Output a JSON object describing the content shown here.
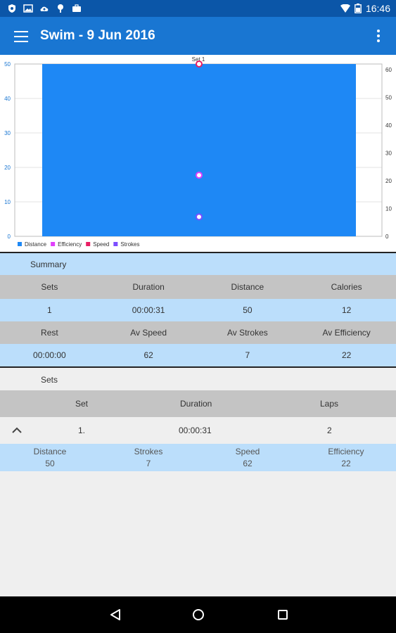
{
  "status_bar": {
    "time": "16:46",
    "left_icons": [
      "shield-icon",
      "image-icon",
      "cloud-upload-icon",
      "location-icon",
      "briefcase-icon"
    ],
    "right_icons": [
      "wifi-icon",
      "battery-icon"
    ]
  },
  "app_bar": {
    "title": "Swim - 9 Jun 2016",
    "background": "#1976d2"
  },
  "chart_data": {
    "type": "bar",
    "title": "Set 1",
    "categories": [
      "Set 1"
    ],
    "left_axis": {
      "ticks": [
        "0",
        "10",
        "20",
        "30",
        "40",
        "50"
      ],
      "ylim": [
        0,
        50
      ]
    },
    "right_axis": {
      "ticks": [
        "0",
        "10",
        "20",
        "30",
        "40",
        "50",
        "60"
      ],
      "ylim": [
        0,
        62
      ]
    },
    "series": [
      {
        "name": "Distance",
        "kind": "bar",
        "axis": "left",
        "values": [
          50
        ],
        "color": "#1e88f5"
      },
      {
        "name": "Efficiency",
        "kind": "point",
        "axis": "right",
        "values": [
          22
        ],
        "color": "#e040fb"
      },
      {
        "name": "Speed",
        "kind": "point",
        "axis": "right",
        "values": [
          62
        ],
        "color": "#e91e63"
      },
      {
        "name": "Strokes",
        "kind": "point",
        "axis": "right",
        "values": [
          7
        ],
        "color": "#7c4dff"
      }
    ],
    "legend_position": "bottom-left"
  },
  "summary": {
    "label": "Summary",
    "headers1": [
      "Sets",
      "Duration",
      "Distance",
      "Calories"
    ],
    "values1": [
      "1",
      "00:00:31",
      "50",
      "12"
    ],
    "headers2": [
      "Rest",
      "Av Speed",
      "Av Strokes",
      "Av Efficiency"
    ],
    "values2": [
      "00:00:00",
      "62",
      "7",
      "22"
    ]
  },
  "sets": {
    "label": "Sets",
    "columns": [
      "Set",
      "Duration",
      "Laps"
    ],
    "rows": [
      {
        "set": "1.",
        "duration": "00:00:31",
        "laps": "2",
        "details": {
          "labels": [
            "Distance",
            "Strokes",
            "Speed",
            "Efficiency"
          ],
          "values": [
            "50",
            "7",
            "62",
            "22"
          ]
        }
      }
    ]
  },
  "nav": [
    "back-icon",
    "home-icon",
    "recents-icon"
  ]
}
